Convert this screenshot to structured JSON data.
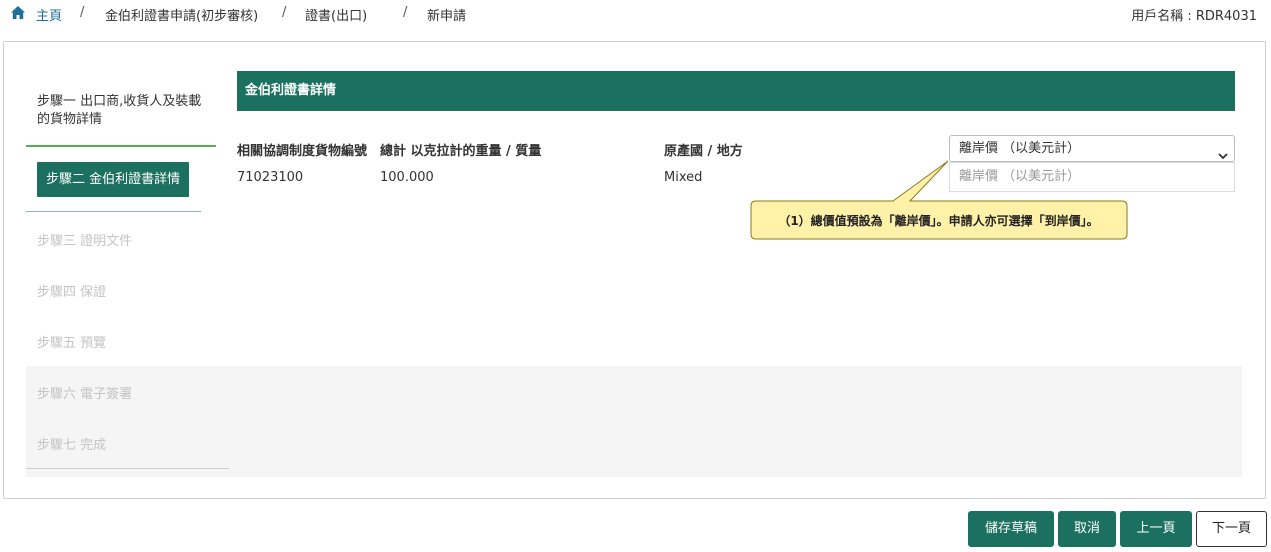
{
  "breadcrumb": {
    "home": "主頁",
    "level1": "金伯利證書申請(初步審核)",
    "level2": "證書(出口)",
    "level3": "新申請",
    "separator": "/"
  },
  "user": {
    "label": "用戶名稱 : RDR4031"
  },
  "steps": {
    "step1": "步驟一 出口商,收貨人及裝載的貨物詳情",
    "step2": "步驟二 金伯利證書詳情",
    "step3": "步驟三 證明文件",
    "step4": "步驟四 保證",
    "step5": "步驟五 預覽",
    "step6": "步驟六 電子簽署",
    "step7": "步驟七 完成"
  },
  "section": {
    "title": "金伯利證書詳情"
  },
  "table": {
    "headers": [
      "相關協調制度貨物編號",
      "總計 以克拉計的重量 / 質量",
      "原產國 / 地方"
    ],
    "row": [
      "71023100",
      "100.000",
      "Mixed"
    ]
  },
  "price_select": {
    "selected": "離岸價 （以美元計）",
    "option": "離岸價 （以美元計）"
  },
  "callout": {
    "text": "（1）總價值預設為「離岸價」。申請人亦可選擇「到岸價」。"
  },
  "buttons": {
    "save": "儲存草稿",
    "cancel": "取消",
    "prev": "上一頁",
    "next": "下一頁"
  },
  "colors": {
    "primary": "#1c7060",
    "link": "#1f6f9a",
    "callout_fill": "#fff2a8",
    "callout_border": "#8a7a20"
  }
}
